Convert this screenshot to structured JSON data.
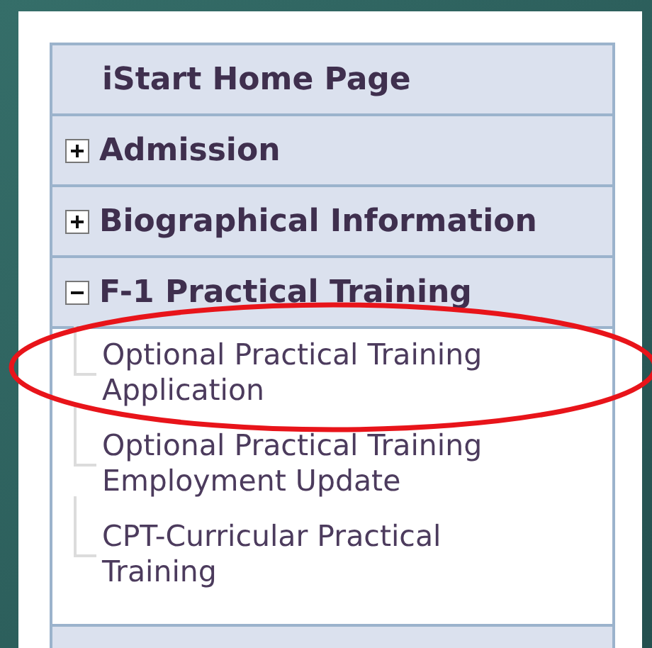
{
  "menu": [
    {
      "kind": "link",
      "label": "iStart Home Page"
    },
    {
      "kind": "section",
      "label": "Admission",
      "expanded": false
    },
    {
      "kind": "section",
      "label": "Biographical Information",
      "expanded": false
    },
    {
      "kind": "section",
      "label": "F-1 Practical Training",
      "expanded": true,
      "children": [
        {
          "label": "Optional Practical Training Application"
        },
        {
          "label": "Optional Practical Training Employment Update"
        },
        {
          "label": "CPT-Curricular Practical Training"
        }
      ]
    }
  ]
}
